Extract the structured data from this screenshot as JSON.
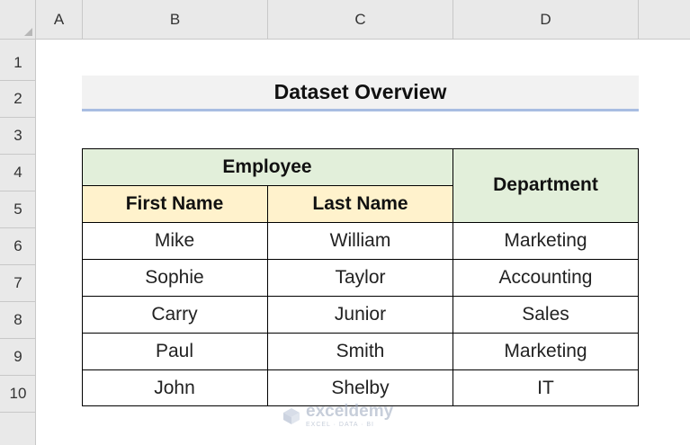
{
  "columns": [
    "A",
    "B",
    "C",
    "D"
  ],
  "rows": [
    "1",
    "2",
    "3",
    "4",
    "5",
    "6",
    "7",
    "8",
    "9",
    "10"
  ],
  "title": "Dataset Overview",
  "table": {
    "group_header": "Employee",
    "department_header": "Department",
    "first_name_header": "First Name",
    "last_name_header": "Last Name",
    "records": [
      {
        "first": "Mike",
        "last": "William",
        "dept": "Marketing"
      },
      {
        "first": "Sophie",
        "last": "Taylor",
        "dept": "Accounting"
      },
      {
        "first": "Carry",
        "last": "Junior",
        "dept": "Sales"
      },
      {
        "first": "Paul",
        "last": "Smith",
        "dept": "Marketing"
      },
      {
        "first": "John",
        "last": "Shelby",
        "dept": "IT"
      }
    ]
  },
  "watermark": {
    "name": "exceldemy",
    "tagline": "EXCEL · DATA · BI"
  },
  "colors": {
    "group_header_bg": "#e2efda",
    "subheader_bg": "#fff2cc",
    "title_underline": "#a8bde2"
  }
}
